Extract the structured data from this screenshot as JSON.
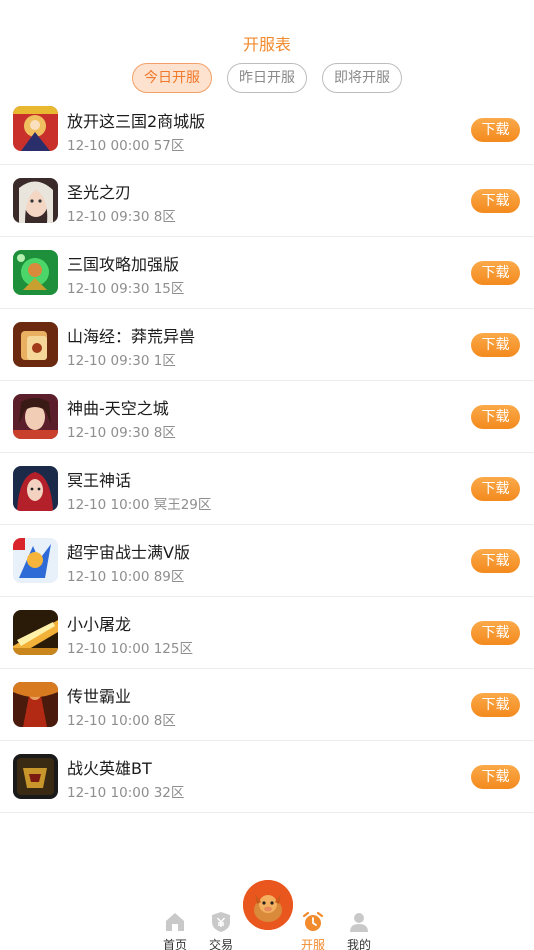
{
  "header": {
    "title": "开服表",
    "tabs": [
      {
        "label": "今日开服",
        "active": true
      },
      {
        "label": "昨日开服",
        "active": false
      },
      {
        "label": "即将开服",
        "active": false
      }
    ]
  },
  "download_label": "下载",
  "games": [
    {
      "name": "放开这三国2商城版",
      "meta": "12-10 00:00 57区",
      "icon": "three-kingdoms-warrior-icon"
    },
    {
      "name": "圣光之刃",
      "meta": "12-10 09:30 8区",
      "icon": "girl-portrait-icon"
    },
    {
      "name": "三国攻略加强版",
      "meta": "12-10 09:30 15区",
      "icon": "green-general-icon"
    },
    {
      "name": "山海经：莽荒异兽",
      "meta": "12-10 09:30 1区",
      "icon": "beast-mahjong-icon"
    },
    {
      "name": "神曲-天空之城",
      "meta": "12-10 09:30 8区",
      "icon": "heroine-icon"
    },
    {
      "name": "冥王神话",
      "meta": "12-10 10:00 冥王29区",
      "icon": "red-hair-girl-icon"
    },
    {
      "name": "超宇宙战士满V版",
      "meta": "12-10 10:00 89区",
      "icon": "cosmic-warrior-icon"
    },
    {
      "name": "小小屠龙",
      "meta": "12-10 10:00 125区",
      "icon": "golden-dragon-icon"
    },
    {
      "name": "传世霸业",
      "meta": "12-10 10:00 8区",
      "icon": "red-knight-icon"
    },
    {
      "name": "战火英雄BT",
      "meta": "12-10 10:00 32区",
      "icon": "war-fire-icon"
    }
  ],
  "tabbar": {
    "items": [
      {
        "label": "首页",
        "icon": "home-icon",
        "active": false
      },
      {
        "label": "交易",
        "icon": "trade-shield-icon",
        "active": false
      },
      {
        "label": "开服",
        "icon": "alarm-clock-icon",
        "active": true
      },
      {
        "label": "我的",
        "icon": "user-icon",
        "active": false
      }
    ],
    "center_icon": "mascot-icon"
  },
  "colors": {
    "accent": "#f28a2e",
    "download": "#f38a1d",
    "tab_active_bg": "#fde3cf"
  }
}
